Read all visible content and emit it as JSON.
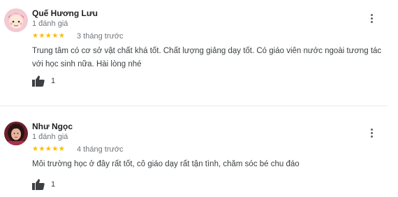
{
  "reviews": [
    {
      "author": "Quế Hương Lưu",
      "review_count": "1 đánh giá",
      "rating": 5,
      "stars": "★★★★★",
      "date": "3 tháng trước",
      "text": "Trung tâm có cơ sở vật chất khá tốt. Chất lượng giảng dạy tốt. Có giáo viên nước ngoài tương tác với học sinh nữa. Hài lòng nhé",
      "likes": "1",
      "avatar_icon": "avatar-photo-icon",
      "like_icon": "thumbs-up-icon",
      "more_icon": "more-vert-icon"
    },
    {
      "author": "Như Ngọc",
      "review_count": "1 đánh giá",
      "rating": 5,
      "stars": "★★★★★",
      "date": "4 tháng trước",
      "text": "Môi trường học ở đây rất tốt, cô giáo dạy rất tận tình, chăm sóc bé chu đáo",
      "likes": "1",
      "avatar_icon": "avatar-photo-icon",
      "like_icon": "thumbs-up-icon",
      "more_icon": "more-vert-icon"
    }
  ],
  "colors": {
    "star": "#fbbc04",
    "secondary_text": "#70757a",
    "divider": "#e8eaed"
  }
}
